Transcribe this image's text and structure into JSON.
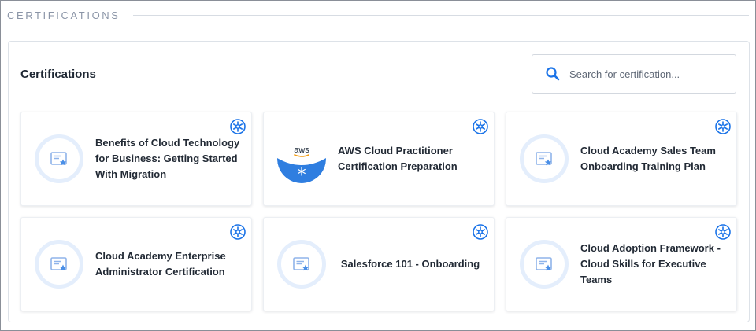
{
  "section": {
    "heading": "CERTIFICATIONS"
  },
  "panel": {
    "title": "Certifications",
    "search": {
      "placeholder": "Search for certification...",
      "value": ""
    }
  },
  "cards": [
    {
      "title": "Benefits of Cloud Technology for Business: Getting Started With Migration",
      "thumbnail": "certificate-icon",
      "badge": "snowflake-badge-icon"
    },
    {
      "title": "AWS Cloud Practitioner Certification Preparation",
      "thumbnail": "aws-logo",
      "thumbnail_text": "aws",
      "badge": "snowflake-badge-icon"
    },
    {
      "title": "Cloud Academy Sales Team Onboarding Training Plan",
      "thumbnail": "certificate-icon",
      "badge": "snowflake-badge-icon"
    },
    {
      "title": "Cloud Academy Enterprise Administrator Certification",
      "thumbnail": "certificate-icon",
      "badge": "snowflake-badge-icon"
    },
    {
      "title": "Salesforce 101 - Onboarding",
      "thumbnail": "certificate-icon",
      "badge": "snowflake-badge-icon"
    },
    {
      "title": "Cloud Adoption Framework - Cloud Skills for Executive Teams",
      "thumbnail": "certificate-icon",
      "badge": "snowflake-badge-icon"
    }
  ],
  "colors": {
    "accent": "#1a73e8",
    "heading_gray": "#8b95a7",
    "cert_ring": "#e4eefc",
    "aws_blue": "#2f7ee0"
  }
}
